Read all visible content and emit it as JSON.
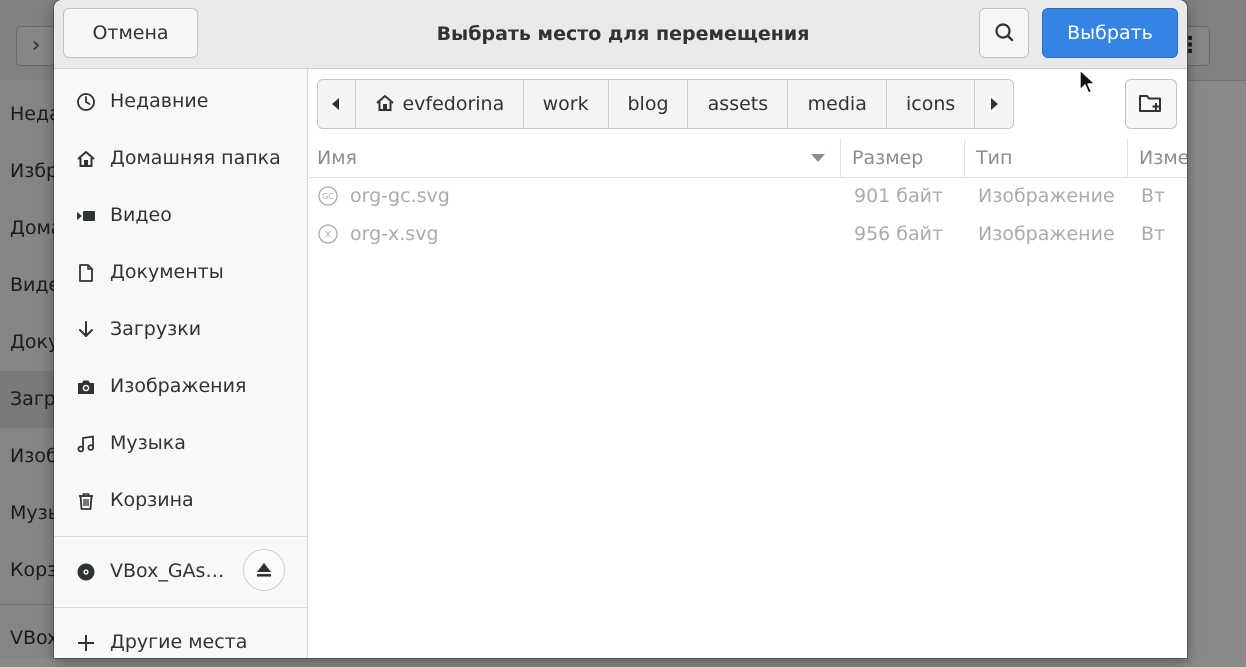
{
  "background_window": {
    "sidebar_items": [
      "Недавние",
      "Избранное",
      "Домашняя папка",
      "Видео",
      "Документы",
      "Загрузки",
      "Изображения",
      "Музыка",
      "Корзина",
      "VBox_GAs"
    ]
  },
  "dialog": {
    "title": "Выбрать место для перемещения",
    "cancel_label": "Отмена",
    "select_label": "Выбрать",
    "accent_color": "#3584e4"
  },
  "places": {
    "items": [
      {
        "label": "Недавние",
        "icon": "clock-icon"
      },
      {
        "label": "Домашняя папка",
        "icon": "home-icon"
      },
      {
        "label": "Видео",
        "icon": "video-icon"
      },
      {
        "label": "Документы",
        "icon": "document-icon"
      },
      {
        "label": "Загрузки",
        "icon": "download-icon"
      },
      {
        "label": "Изображения",
        "icon": "camera-icon"
      },
      {
        "label": "Музыка",
        "icon": "music-icon"
      },
      {
        "label": "Корзина",
        "icon": "trash-icon"
      }
    ],
    "device": {
      "label": "VBox_GAs…",
      "icon": "disc-icon"
    },
    "other_locations": {
      "label": "Другие места",
      "icon": "plus-icon"
    }
  },
  "pathbar": {
    "crumbs": [
      "evfedorina",
      "work",
      "blog",
      "assets",
      "media",
      "icons"
    ]
  },
  "columns": {
    "name": "Имя",
    "size": "Размер",
    "type": "Тип",
    "modified": "Изменён"
  },
  "files": [
    {
      "name": "org-gc.svg",
      "icon_text": "GC",
      "size": "901 байт",
      "type": "Изображение",
      "modified": "Вт"
    },
    {
      "name": "org-x.svg",
      "icon_text": "X",
      "size": "956 байт",
      "type": "Изображение",
      "modified": "Вт"
    }
  ]
}
